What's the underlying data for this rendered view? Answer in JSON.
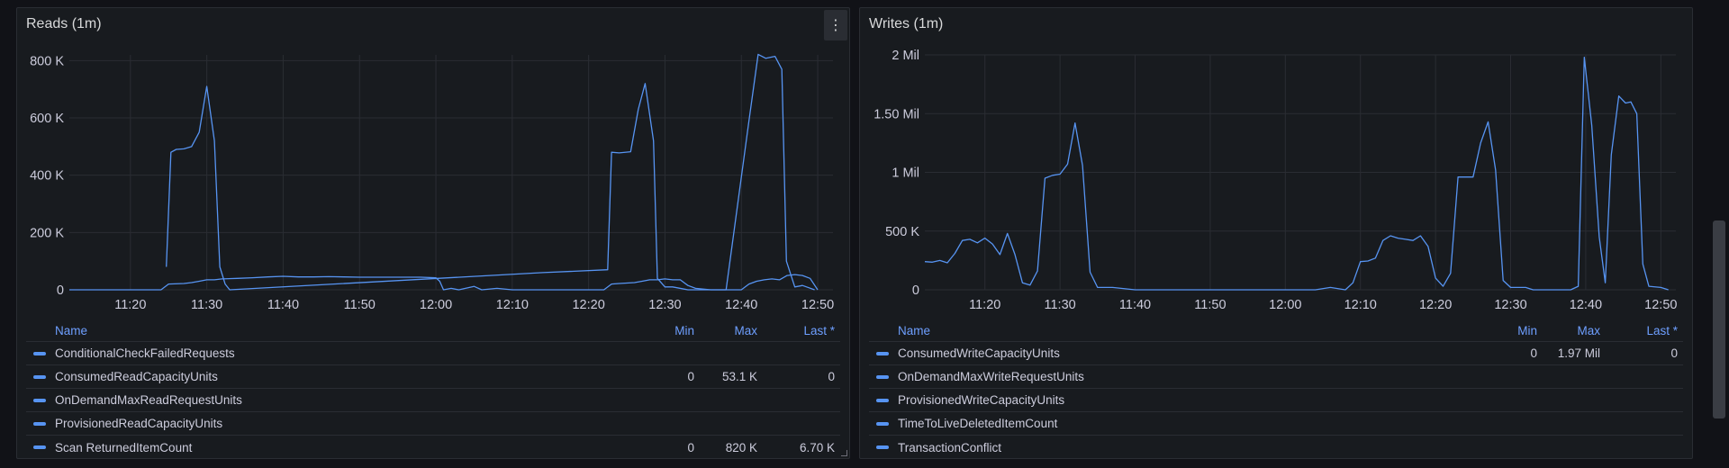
{
  "colors": {
    "series": "#5794f2",
    "legend_header": "#6e9fff",
    "grid": "#2a2d33"
  },
  "reads": {
    "title": "Reads (1m)",
    "menu_icon": "⋮",
    "legend": {
      "header": {
        "name": "Name",
        "min": "Min",
        "max": "Max",
        "last": "Last *"
      },
      "rows": [
        {
          "name": "ConditionalCheckFailedRequests",
          "min": "",
          "max": "",
          "last": ""
        },
        {
          "name": "ConsumedReadCapacityUnits",
          "min": "0",
          "max": "53.1 K",
          "last": "0"
        },
        {
          "name": "OnDemandMaxReadRequestUnits",
          "min": "",
          "max": "",
          "last": ""
        },
        {
          "name": "ProvisionedReadCapacityUnits",
          "min": "",
          "max": "",
          "last": ""
        },
        {
          "name": "Scan ReturnedItemCount",
          "min": "0",
          "max": "820 K",
          "last": "6.70 K"
        }
      ]
    }
  },
  "writes": {
    "title": "Writes (1m)",
    "legend": {
      "header": {
        "name": "Name",
        "min": "Min",
        "max": "Max",
        "last": "Last *"
      },
      "rows": [
        {
          "name": "ConsumedWriteCapacityUnits",
          "min": "0",
          "max": "1.97 Mil",
          "last": "0"
        },
        {
          "name": "OnDemandMaxWriteRequestUnits",
          "min": "",
          "max": "",
          "last": ""
        },
        {
          "name": "ProvisionedWriteCapacityUnits",
          "min": "",
          "max": "",
          "last": ""
        },
        {
          "name": "TimeToLiveDeletedItemCount",
          "min": "",
          "max": "",
          "last": ""
        },
        {
          "name": "TransactionConflict",
          "min": "",
          "max": "",
          "last": ""
        }
      ]
    }
  },
  "chart_data": [
    {
      "type": "line",
      "title": "Reads (1m)",
      "x_unit": "minutes since 11:12",
      "xlim": [
        0,
        100
      ],
      "ylim": [
        0,
        820000
      ],
      "x_ticks": [
        {
          "label": "11:20",
          "x": 8
        },
        {
          "label": "11:30",
          "x": 18
        },
        {
          "label": "11:40",
          "x": 28
        },
        {
          "label": "11:50",
          "x": 38
        },
        {
          "label": "12:00",
          "x": 48
        },
        {
          "label": "12:10",
          "x": 58
        },
        {
          "label": "12:20",
          "x": 68
        },
        {
          "label": "12:30",
          "x": 78
        },
        {
          "label": "12:40",
          "x": 88
        },
        {
          "label": "12:50",
          "x": 98
        }
      ],
      "y_ticks": [
        {
          "label": "0",
          "y": 0
        },
        {
          "label": "200 K",
          "y": 200000
        },
        {
          "label": "400 K",
          "y": 400000
        },
        {
          "label": "600 K",
          "y": 600000
        },
        {
          "label": "800 K",
          "y": 800000
        }
      ],
      "series": [
        {
          "name": "Scan ReturnedItemCount",
          "points": [
            [
              12.7,
              80000
            ],
            [
              13.3,
              480000
            ],
            [
              14,
              490000
            ],
            [
              15,
              492000
            ],
            [
              16,
              500000
            ],
            [
              17,
              550000
            ],
            [
              18,
              710000
            ],
            [
              19,
              520000
            ],
            [
              19.7,
              80000
            ],
            [
              20.4,
              20000
            ],
            [
              21,
              0
            ],
            [
              62,
              60000
            ],
            [
              70.5,
              70000
            ],
            [
              71,
              480000
            ],
            [
              72,
              478000
            ],
            [
              73.5,
              482000
            ],
            [
              74.5,
              630000
            ],
            [
              75.4,
              720000
            ],
            [
              76.5,
              520000
            ],
            [
              77,
              40000
            ],
            [
              78,
              10000
            ],
            [
              79,
              10000
            ],
            [
              81,
              0
            ],
            [
              86,
              0
            ],
            [
              89,
              590000
            ],
            [
              90.2,
              822000
            ],
            [
              91.2,
              808000
            ],
            [
              92.4,
              815000
            ],
            [
              93.3,
              770000
            ],
            [
              93.9,
              100000
            ],
            [
              95,
              10000
            ],
            [
              96,
              15000
            ],
            [
              97.6,
              0
            ]
          ]
        },
        {
          "name": "ConsumedReadCapacityUnits",
          "points": [
            [
              0,
              0
            ],
            [
              12,
              0
            ],
            [
              13,
              20000
            ],
            [
              15,
              22000
            ],
            [
              16,
              25000
            ],
            [
              17,
              30000
            ],
            [
              18,
              35000
            ],
            [
              19,
              35000
            ],
            [
              20,
              38000
            ],
            [
              22,
              40000
            ],
            [
              24,
              42000
            ],
            [
              26,
              45000
            ],
            [
              28,
              47000
            ],
            [
              30,
              45000
            ],
            [
              32,
              45000
            ],
            [
              34,
              46000
            ],
            [
              36,
              45000
            ],
            [
              38,
              44000
            ],
            [
              42,
              44000
            ],
            [
              46,
              44000
            ],
            [
              48,
              42000
            ],
            [
              48.5,
              30000
            ],
            [
              49,
              0
            ],
            [
              50,
              5000
            ],
            [
              51,
              0
            ],
            [
              53,
              12000
            ],
            [
              54,
              0
            ],
            [
              56,
              5000
            ],
            [
              58,
              0
            ],
            [
              62,
              0
            ],
            [
              66,
              0
            ],
            [
              70,
              0
            ],
            [
              71,
              20000
            ],
            [
              72,
              22000
            ],
            [
              74,
              25000
            ],
            [
              75,
              30000
            ],
            [
              76,
              35000
            ],
            [
              77,
              35000
            ],
            [
              78,
              38000
            ],
            [
              79,
              35000
            ],
            [
              80,
              35000
            ],
            [
              81,
              15000
            ],
            [
              82,
              5000
            ],
            [
              84,
              0
            ],
            [
              88,
              0
            ],
            [
              89,
              20000
            ],
            [
              90,
              30000
            ],
            [
              91,
              35000
            ],
            [
              92,
              38000
            ],
            [
              93,
              35000
            ],
            [
              94,
              50000
            ],
            [
              95,
              53100
            ],
            [
              96,
              50000
            ],
            [
              97,
              40000
            ],
            [
              98,
              0
            ]
          ]
        }
      ]
    },
    {
      "type": "line",
      "title": "Writes (1m)",
      "x_unit": "minutes since 11:12",
      "xlim": [
        0,
        100
      ],
      "ylim": [
        0,
        2000000
      ],
      "x_ticks": [
        {
          "label": "11:20",
          "x": 8
        },
        {
          "label": "11:30",
          "x": 18
        },
        {
          "label": "11:40",
          "x": 28
        },
        {
          "label": "11:50",
          "x": 38
        },
        {
          "label": "12:00",
          "x": 48
        },
        {
          "label": "12:10",
          "x": 58
        },
        {
          "label": "12:20",
          "x": 68
        },
        {
          "label": "12:30",
          "x": 78
        },
        {
          "label": "12:40",
          "x": 88
        },
        {
          "label": "12:50",
          "x": 98
        }
      ],
      "y_ticks": [
        {
          "label": "0",
          "y": 0
        },
        {
          "label": "500 K",
          "y": 500000
        },
        {
          "label": "1 Mil",
          "y": 1000000
        },
        {
          "label": "1.50 Mil",
          "y": 1500000
        },
        {
          "label": "2 Mil",
          "y": 2000000
        }
      ],
      "series": [
        {
          "name": "ConsumedWriteCapacityUnits",
          "points": [
            [
              0,
              240000
            ],
            [
              1,
              235000
            ],
            [
              2,
              250000
            ],
            [
              3,
              230000
            ],
            [
              4,
              310000
            ],
            [
              5,
              420000
            ],
            [
              6,
              430000
            ],
            [
              7,
              400000
            ],
            [
              8,
              440000
            ],
            [
              9,
              390000
            ],
            [
              10,
              300000
            ],
            [
              11,
              480000
            ],
            [
              12,
              300000
            ],
            [
              13,
              60000
            ],
            [
              14,
              40000
            ],
            [
              15,
              160000
            ],
            [
              16,
              950000
            ],
            [
              17,
              975000
            ],
            [
              18,
              985000
            ],
            [
              19,
              1070000
            ],
            [
              20,
              1420000
            ],
            [
              21,
              1060000
            ],
            [
              22,
              150000
            ],
            [
              23,
              20000
            ],
            [
              25,
              20000
            ],
            [
              28,
              0
            ],
            [
              38,
              0
            ],
            [
              48,
              0
            ],
            [
              52,
              0
            ],
            [
              54,
              20000
            ],
            [
              56,
              0
            ],
            [
              57,
              60000
            ],
            [
              58,
              240000
            ],
            [
              59,
              245000
            ],
            [
              60,
              270000
            ],
            [
              61,
              420000
            ],
            [
              62,
              460000
            ],
            [
              63,
              440000
            ],
            [
              64,
              430000
            ],
            [
              65,
              420000
            ],
            [
              66,
              460000
            ],
            [
              67,
              370000
            ],
            [
              68,
              100000
            ],
            [
              69,
              30000
            ],
            [
              70,
              140000
            ],
            [
              71,
              960000
            ],
            [
              73,
              960000
            ],
            [
              74,
              1250000
            ],
            [
              75,
              1430000
            ],
            [
              76,
              1020000
            ],
            [
              77,
              80000
            ],
            [
              78,
              20000
            ],
            [
              80,
              20000
            ],
            [
              81,
              0
            ],
            [
              84,
              0
            ],
            [
              86,
              0
            ],
            [
              87,
              30000
            ],
            [
              87.8,
              1980000
            ],
            [
              88.8,
              1400000
            ],
            [
              89.8,
              450000
            ],
            [
              90.6,
              60000
            ],
            [
              91.4,
              1150000
            ],
            [
              92.4,
              1650000
            ],
            [
              93.3,
              1590000
            ],
            [
              94,
              1600000
            ],
            [
              94.8,
              1500000
            ],
            [
              95.6,
              220000
            ],
            [
              96.4,
              30000
            ],
            [
              98,
              20000
            ],
            [
              99,
              0
            ]
          ]
        }
      ]
    }
  ]
}
